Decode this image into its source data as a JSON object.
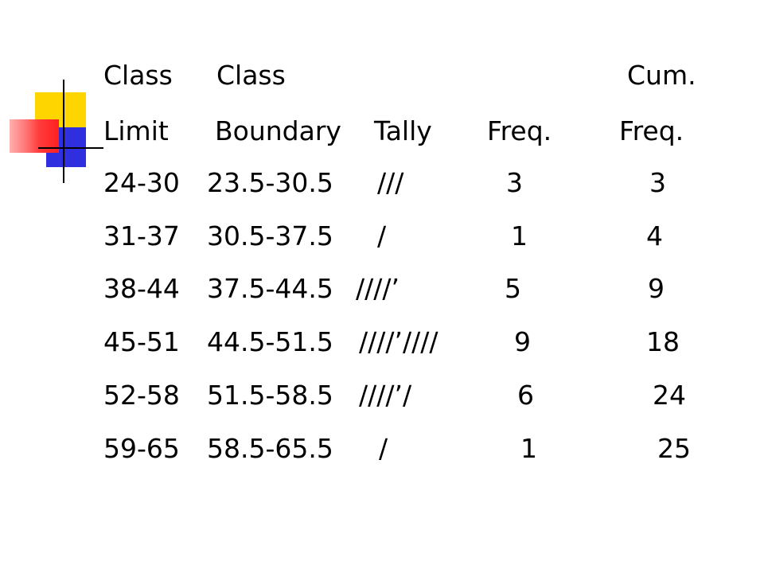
{
  "header": {
    "row1": {
      "class_a": "Class",
      "class_b": "Class",
      "cum": "Cum."
    },
    "row2": {
      "limit": "Limit",
      "boundary": "Boundary",
      "tally": "Tally",
      "freq": "Freq.",
      "cum_freq": "Freq."
    }
  },
  "rows": [
    {
      "limit": "24-30",
      "boundary": "23.5-30.5",
      "tally": "///",
      "freq": "3",
      "cum_freq": "3"
    },
    {
      "limit": "31-37",
      "boundary": "30.5-37.5",
      "tally": "/",
      "freq": "1",
      "cum_freq": "4"
    },
    {
      "limit": "38-44",
      "boundary": "37.5-44.5",
      "tally": "////’",
      "freq": "5",
      "cum_freq": "9"
    },
    {
      "limit": "45-51",
      "boundary": "44.5-51.5",
      "tally": "////’////",
      "freq": "9",
      "cum_freq": "18"
    },
    {
      "limit": "52-58",
      "boundary": "51.5-58.5",
      "tally": "////’/",
      "freq": "6",
      "cum_freq": "24"
    },
    {
      "limit": "59-65",
      "boundary": "58.5-65.5",
      "tally": "/",
      "freq": "1",
      "cum_freq": "25"
    }
  ],
  "colors": {
    "accent_yellow": "#FFD500",
    "accent_blue": "#2F2FE0",
    "accent_red": "#FF3333",
    "line": "#000000"
  }
}
